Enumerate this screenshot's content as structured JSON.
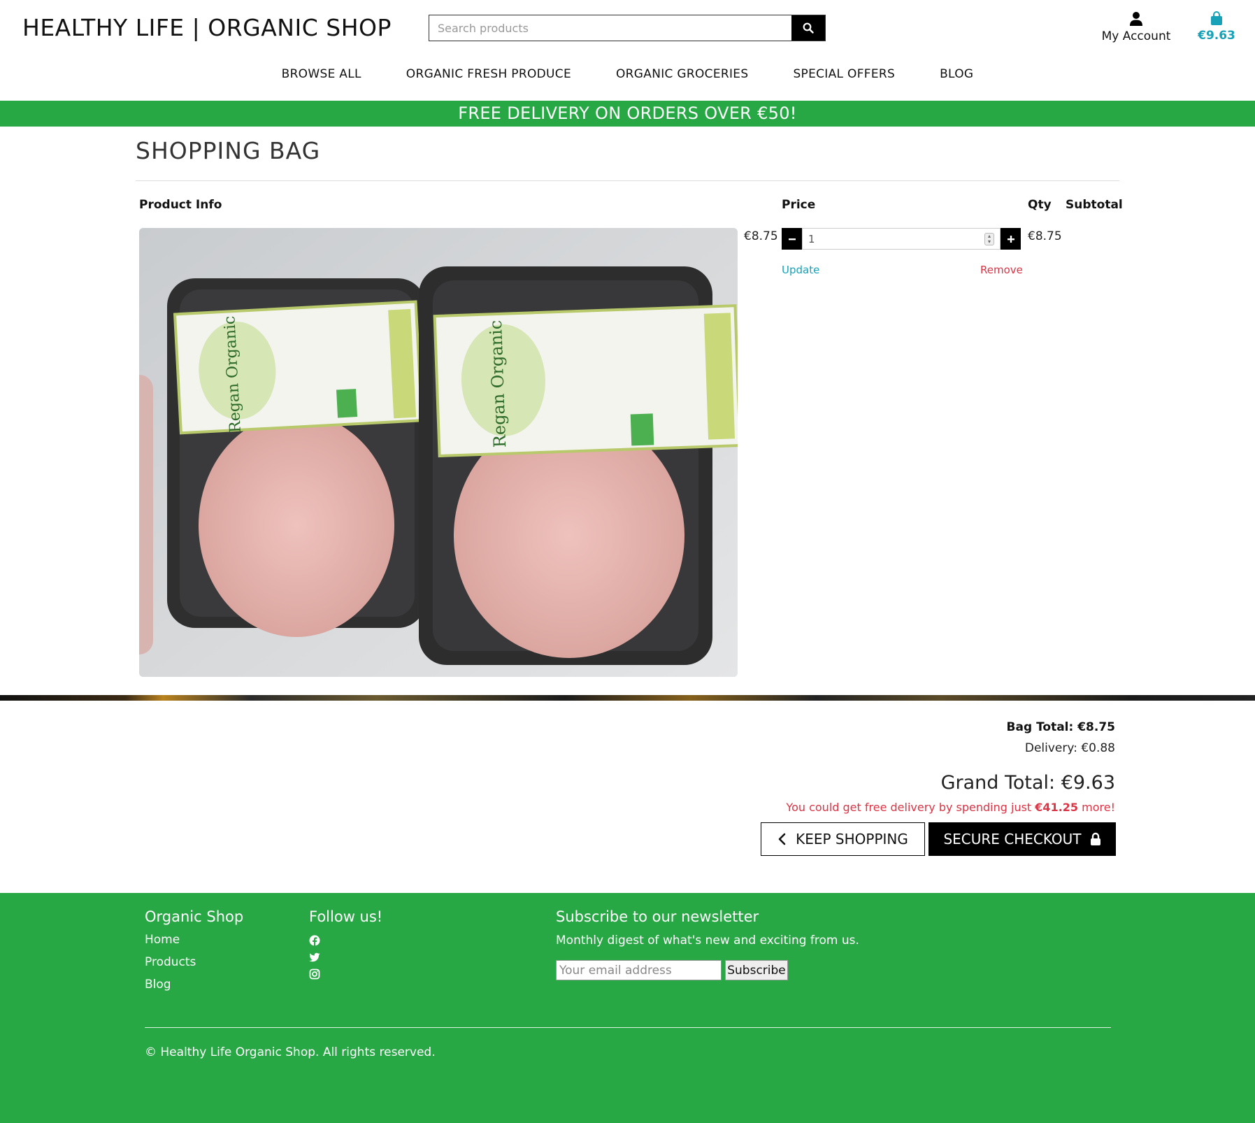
{
  "header": {
    "brand": "HEALTHY LIFE | ORGANIC SHOP",
    "search_placeholder": "Search products",
    "account_label": "My Account",
    "cart_total": "€9.63"
  },
  "nav": {
    "items": [
      {
        "label": "BROWSE ALL"
      },
      {
        "label": "ORGANIC FRESH PRODUCE"
      },
      {
        "label": "ORGANIC GROCERIES"
      },
      {
        "label": "SPECIAL OFFERS"
      },
      {
        "label": "BLOG"
      }
    ]
  },
  "banner": {
    "text": "FREE DELIVERY ON ORDERS OVER €50!"
  },
  "main": {
    "title": "SHOPPING BAG",
    "columns": {
      "product_info": "Product Info",
      "price": "Price",
      "qty": "Qty",
      "subtotal": "Subtotal"
    },
    "items": [
      {
        "price": "€8.75",
        "quantity": "1",
        "subtotal": "€8.75",
        "update_label": "Update",
        "remove_label": "Remove"
      }
    ]
  },
  "totals": {
    "bag_total": "Bag Total: €8.75",
    "delivery": "Delivery: €0.88",
    "grand_total": "Grand Total: €9.63",
    "free_msg_prefix": "You could get free delivery by spending just",
    "free_msg_amount": "€41.25",
    "free_msg_suffix": "more!"
  },
  "buttons": {
    "keep_shopping": "KEEP SHOPPING",
    "secure_checkout": "SECURE CHECKOUT"
  },
  "footer": {
    "col1_title": "Organic Shop",
    "links": [
      "Home",
      "Products",
      "Blog"
    ],
    "col2_title": "Follow us!",
    "social": [
      "facebook-icon",
      "twitter-icon",
      "instagram-icon"
    ],
    "col3_title": "Subscribe to our newsletter",
    "newsletter_desc": "Monthly digest of what's new and exciting from us.",
    "email_placeholder": "Your email address",
    "subscribe_label": "Subscribe",
    "copyright": "© Healthy Life Organic Shop. All rights reserved."
  },
  "colors": {
    "accent_green": "#28a745",
    "cart_teal": "#17a2b8",
    "remove_red": "#dc3545"
  }
}
